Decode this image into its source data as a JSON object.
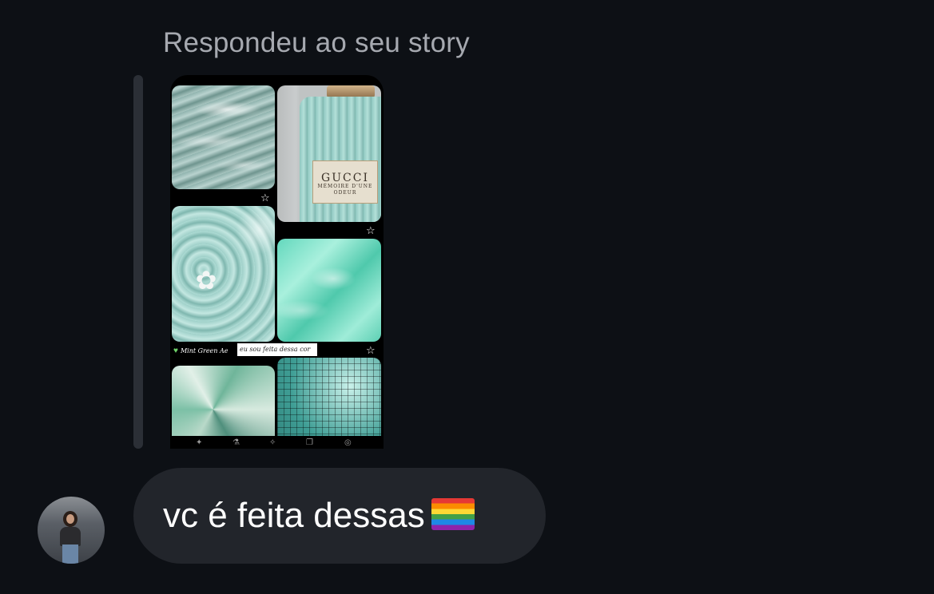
{
  "reply_header": {
    "label": "Respondeu ao seu story"
  },
  "story_preview": {
    "bottle_brand": "GUCCI",
    "bottle_subtitle": "MÉMOIRE D'UNE ODEUR",
    "caption_title": "Mint Green Ae",
    "caption_overlay": "eu sou feita dessa cor",
    "icons": [
      "star-icon",
      "flower-icon",
      "heart-icon"
    ]
  },
  "message": {
    "text": "vc é feita dessas",
    "emoji": "rainbow-flag-icon"
  },
  "colors": {
    "background": "#0d1015",
    "bubble": "#22252b",
    "label_text": "#a6a9b0",
    "message_text": "#ffffff"
  }
}
